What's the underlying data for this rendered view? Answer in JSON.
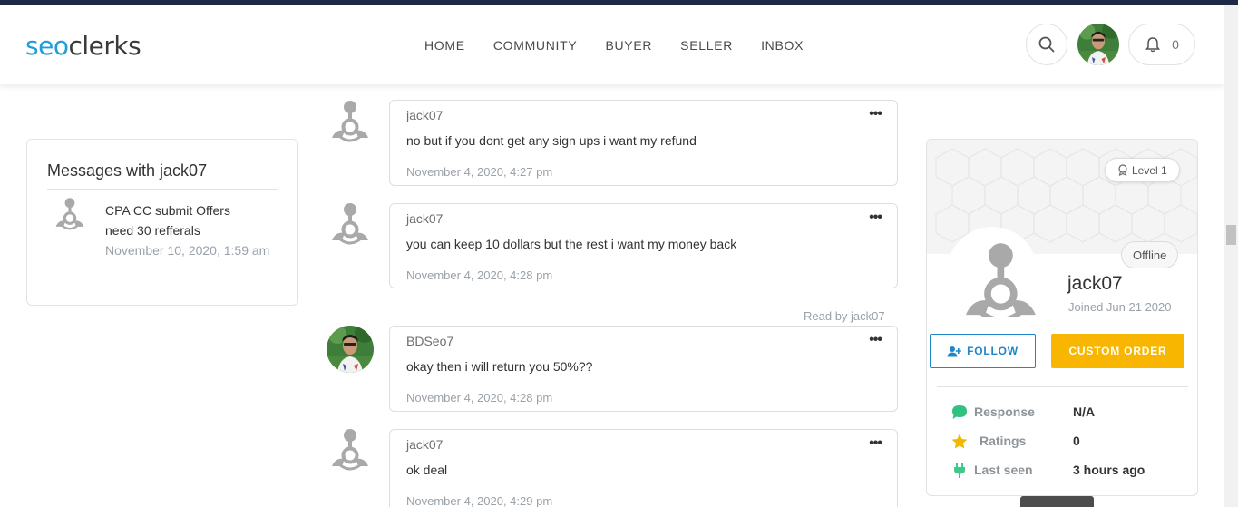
{
  "brand": {
    "logo_part1": "seo",
    "logo_part2": "clerks"
  },
  "nav": {
    "items": [
      {
        "label": "HOME"
      },
      {
        "label": "COMMUNITY"
      },
      {
        "label": "BUYER"
      },
      {
        "label": "SELLER"
      },
      {
        "label": "INBOX"
      }
    ],
    "notification_count": "0",
    "icons": [
      "search-icon",
      "bell-icon",
      "user-avatar"
    ]
  },
  "sidebar": {
    "title": "Messages with jack07",
    "thread": {
      "subject": "CPA CC submit Offers need 30 refferals",
      "date": "November 10, 2020, 1:59 am"
    }
  },
  "messages": [
    {
      "user": "jack07",
      "text": "no but if you dont get any sign ups i want my refund",
      "date": "November 4, 2020, 4:27 pm"
    },
    {
      "user": "jack07",
      "text": "you can keep 10 dollars but the rest i want my money back",
      "date": "November 4, 2020, 4:28 pm"
    },
    {
      "user": "BDSeo7",
      "text": "okay then i will return you 50%??",
      "date": "November 4, 2020, 4:28 pm"
    },
    {
      "user": "jack07",
      "text": "ok deal",
      "date": "November 4, 2020, 4:29 pm"
    }
  ],
  "read_receipt": "Read by jack07",
  "message_menu_glyph": "•••",
  "profile": {
    "level": "Level 1",
    "status": "Offline",
    "name": "jack07",
    "joined": "Joined Jun 21 2020",
    "follow_label": "FOLLOW",
    "custom_order_label": "CUSTOM ORDER",
    "stats": [
      {
        "label": "Response",
        "value": "N/A",
        "icon": "chat-bubble-icon"
      },
      {
        "label": "Ratings",
        "value": "0",
        "icon": "star-icon"
      },
      {
        "label": "Last seen",
        "value": "3 hours ago",
        "icon": "plug-icon"
      }
    ]
  },
  "colors": {
    "brand_blue": "#1f9ed8",
    "accent_yellow": "#f8b600",
    "follow_blue": "#1f86c9",
    "response_green": "#2ec27e",
    "star_yellow": "#f5b800",
    "plug_green": "#3cc98a"
  }
}
